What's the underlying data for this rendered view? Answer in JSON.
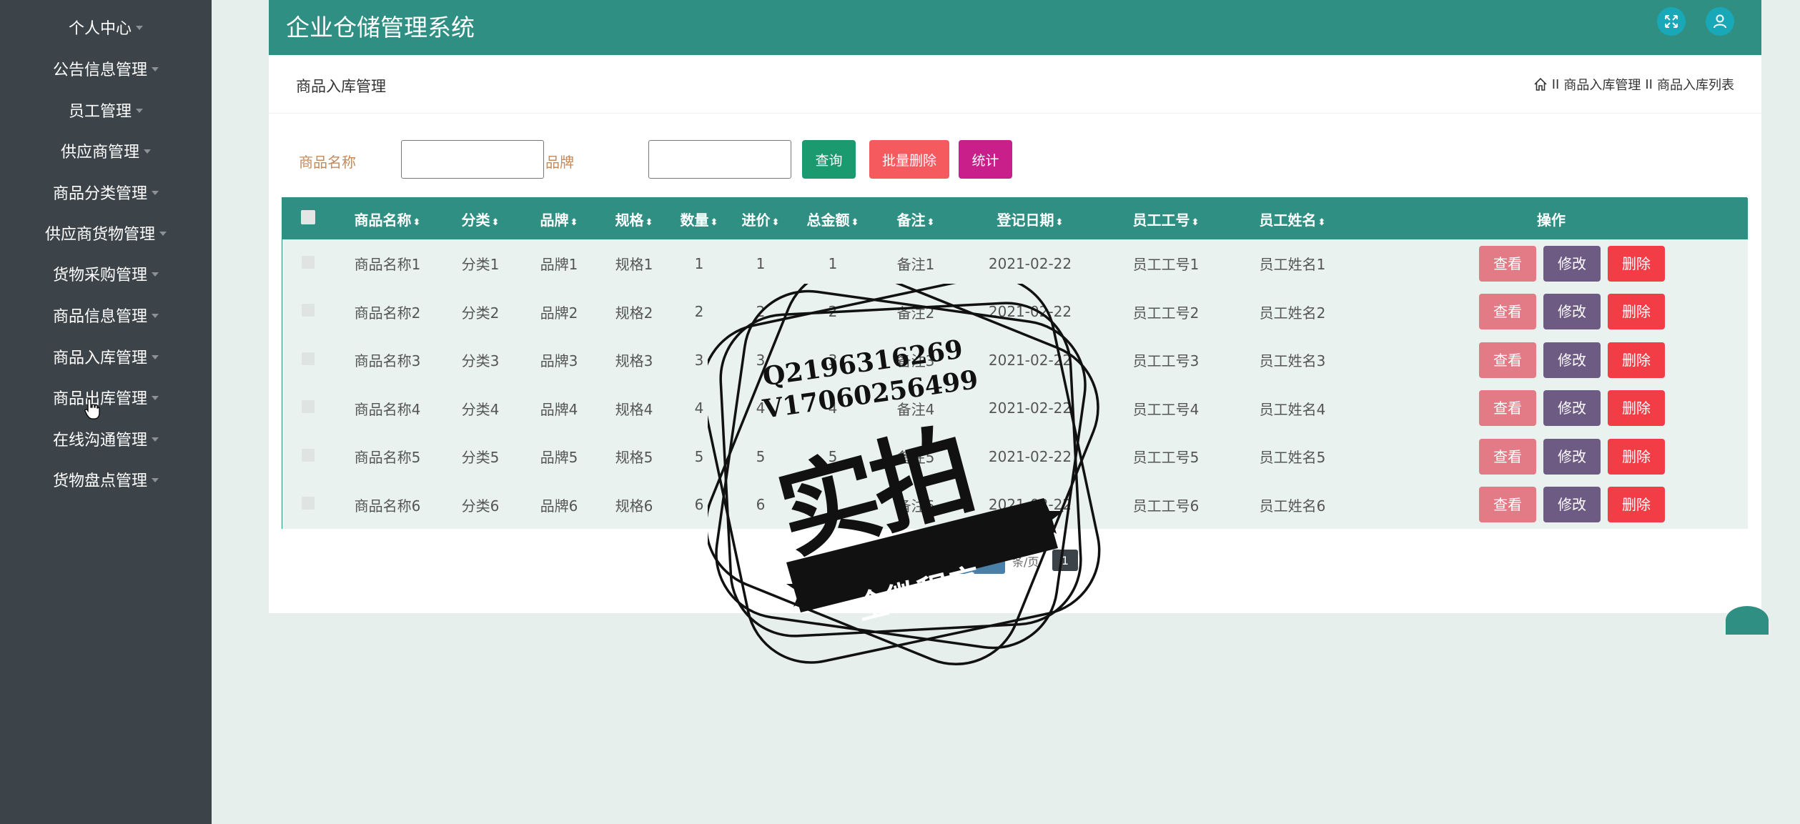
{
  "sidebar": {
    "items": [
      {
        "label": "个人中心"
      },
      {
        "label": "公告信息管理"
      },
      {
        "label": "员工管理"
      },
      {
        "label": "供应商管理"
      },
      {
        "label": "商品分类管理"
      },
      {
        "label": "供应商货物管理"
      },
      {
        "label": "货物采购管理"
      },
      {
        "label": "商品信息管理"
      },
      {
        "label": "商品入库管理"
      },
      {
        "label": "商品出库管理"
      },
      {
        "label": "在线沟通管理"
      },
      {
        "label": "货物盘点管理"
      }
    ]
  },
  "header": {
    "title": "企业仓储管理系统",
    "fullscreen_icon": "expand-icon",
    "user_icon": "user-icon"
  },
  "breadcrumb": {
    "title": "商品入库管理",
    "home_icon": "home-icon",
    "sep": "II",
    "path1": "商品入库管理",
    "path2": "商品入库列表"
  },
  "search": {
    "name_label": "商品名称",
    "name_value": "",
    "brand_label": "品牌",
    "brand_value": "",
    "query_btn": "查询",
    "batch_delete_btn": "批量删除",
    "stats_btn": "统计"
  },
  "colors": {
    "primary": "#2f8f82",
    "sidebar": "#3d4449",
    "query": "#1b9a6f",
    "batch_delete": "#f55a5e",
    "stats": "#c81f8a"
  },
  "table": {
    "headers": [
      "商品名称",
      "分类",
      "品牌",
      "规格",
      "数量",
      "进价",
      "总金额",
      "备注",
      "登记日期",
      "员工工号",
      "员工姓名",
      "操作"
    ],
    "rows": [
      [
        "商品名称1",
        "分类1",
        "品牌1",
        "规格1",
        "1",
        "1",
        "1",
        "备注1",
        "2021-02-22",
        "员工工号1",
        "员工姓名1"
      ],
      [
        "商品名称2",
        "分类2",
        "品牌2",
        "规格2",
        "2",
        "2",
        "2",
        "备注2",
        "2021-02-22",
        "员工工号2",
        "员工姓名2"
      ],
      [
        "商品名称3",
        "分类3",
        "品牌3",
        "规格3",
        "3",
        "3",
        "3",
        "备注3",
        "2021-02-22",
        "员工工号3",
        "员工姓名3"
      ],
      [
        "商品名称4",
        "分类4",
        "品牌4",
        "规格4",
        "4",
        "4",
        "4",
        "备注4",
        "2021-02-22",
        "员工工号4",
        "员工姓名4"
      ],
      [
        "商品名称5",
        "分类5",
        "品牌5",
        "规格5",
        "5",
        "5",
        "5",
        "备注5",
        "2021-02-22",
        "员工工号5",
        "员工姓名5"
      ],
      [
        "商品名称6",
        "分类6",
        "品牌6",
        "规格6",
        "6",
        "6",
        "6",
        "备注6",
        "2021-02-22",
        "员工工号6",
        "员工姓名6"
      ]
    ],
    "view_btn": "查看",
    "edit_btn": "修改",
    "delete_btn": "删除",
    "sort_icon": "sort-icon"
  },
  "pagination": {
    "page_size": "10",
    "per_page_text": "条/页",
    "current_page": "1"
  },
  "watermark": {
    "line1": "Q2196316269",
    "line2": "V17060256499",
    "main": "实拍",
    "banner": "全微程序"
  }
}
